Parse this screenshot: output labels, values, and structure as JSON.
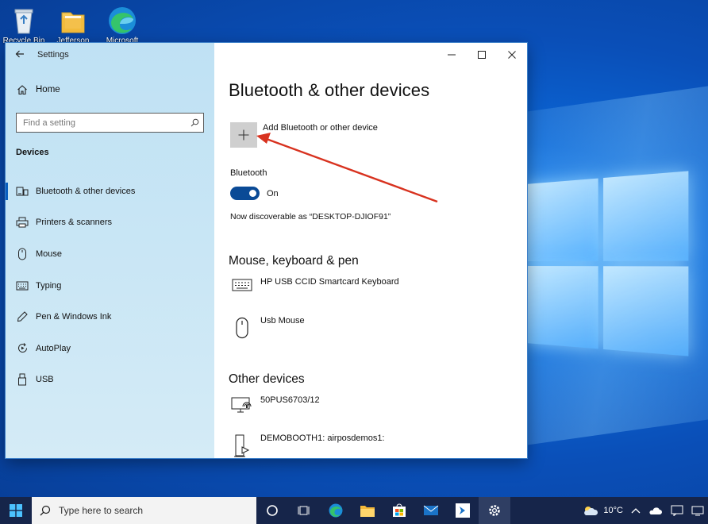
{
  "desktop": {
    "icons": [
      {
        "name": "recycle-bin",
        "label": "Recycle Bin"
      },
      {
        "name": "folder",
        "label": "Jefferson"
      },
      {
        "name": "edge",
        "label": "Microsoft"
      }
    ]
  },
  "window": {
    "title": "Settings",
    "back_icon": "arrow-left-icon",
    "controls": {
      "minimize": "—",
      "maximize": "☐",
      "close": "✕"
    }
  },
  "sidebar": {
    "home_label": "Home",
    "search_placeholder": "Find a setting",
    "section": "Devices",
    "items": [
      {
        "label": "Bluetooth & other devices",
        "icon": "bluetooth-devices-icon",
        "active": true
      },
      {
        "label": "Printers & scanners",
        "icon": "printer-icon"
      },
      {
        "label": "Mouse",
        "icon": "mouse-icon"
      },
      {
        "label": "Typing",
        "icon": "keyboard-icon"
      },
      {
        "label": "Pen & Windows Ink",
        "icon": "pen-icon"
      },
      {
        "label": "AutoPlay",
        "icon": "autoplay-icon"
      },
      {
        "label": "USB",
        "icon": "usb-icon"
      }
    ]
  },
  "main": {
    "title": "Bluetooth & other devices",
    "add_label": "Add Bluetooth or other device",
    "bluetooth": {
      "label": "Bluetooth",
      "state": "On",
      "discoverable": "Now discoverable as “DESKTOP-DJIOF91”"
    },
    "mouse_keyboard_section": "Mouse, keyboard & pen",
    "mouse_keyboard_devices": [
      {
        "name": "HP USB CCID Smartcard Keyboard",
        "icon": "keyboard-icon"
      },
      {
        "name": "Usb Mouse",
        "icon": "mouse-icon"
      }
    ],
    "other_section": "Other devices",
    "other_devices": [
      {
        "name": "50PUS6703/12",
        "icon": "display-wireless-icon"
      },
      {
        "name": "DEMOBOOTH1: airposdemos1:",
        "icon": "media-device-icon"
      }
    ]
  },
  "taskbar": {
    "search_placeholder": "Type here to search",
    "weather": "10°C",
    "colors": {
      "bar": "#16254a",
      "accent": "#0a4a96"
    }
  }
}
